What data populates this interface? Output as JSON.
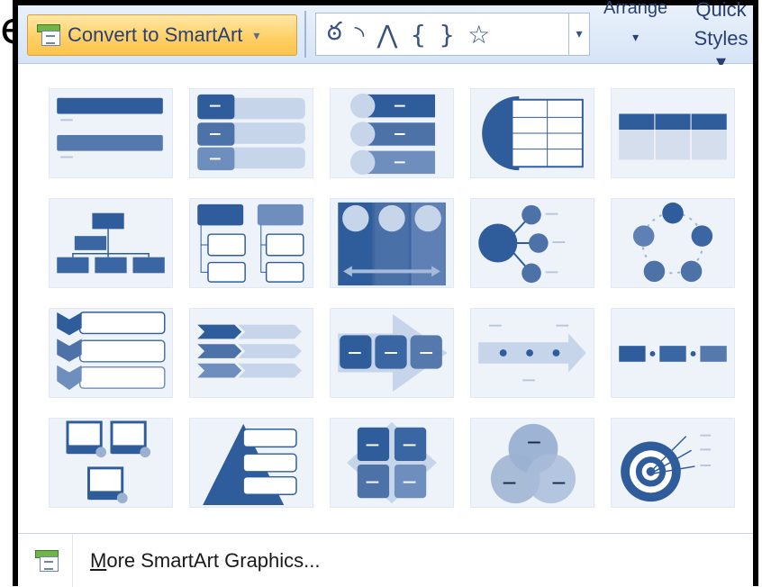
{
  "background_text": "e",
  "ribbon": {
    "convert_button_label": "Convert to SmartArt",
    "convert_button_caret": "▾",
    "shape_glyphs": [
      "ఠ",
      "◝",
      "⋀",
      "{",
      "}",
      "☆"
    ],
    "shapes_scroll_glyph": "▾",
    "arrange_label": "Arrange",
    "arrange_caret": "▾",
    "quick_label": "Quick",
    "styles_label": "Styles ▾"
  },
  "gallery": {
    "items": [
      {
        "name": "basic-block-list"
      },
      {
        "name": "vertical-bullet-list"
      },
      {
        "name": "vertical-circle-list"
      },
      {
        "name": "circle-arrow-table"
      },
      {
        "name": "table-list"
      },
      {
        "name": "organization-chart"
      },
      {
        "name": "hierarchy-list"
      },
      {
        "name": "picture-column-process"
      },
      {
        "name": "radial-list"
      },
      {
        "name": "basic-cycle"
      },
      {
        "name": "vertical-chevron-list"
      },
      {
        "name": "chevron-list"
      },
      {
        "name": "process-arrows"
      },
      {
        "name": "timeline-arrow"
      },
      {
        "name": "basic-process"
      },
      {
        "name": "picture-blocks"
      },
      {
        "name": "pyramid-list"
      },
      {
        "name": "matrix-grid"
      },
      {
        "name": "basic-venn"
      },
      {
        "name": "target-list"
      }
    ]
  },
  "footer": {
    "more_label_rest": "ore SmartArt Graphics...",
    "more_label_mnemonic": "M"
  },
  "colors": {
    "accent_blue": "#2f5d9b",
    "mid_blue": "#5579ad",
    "light_blue": "#c6d5ea",
    "button_gold": "#ffd067"
  }
}
